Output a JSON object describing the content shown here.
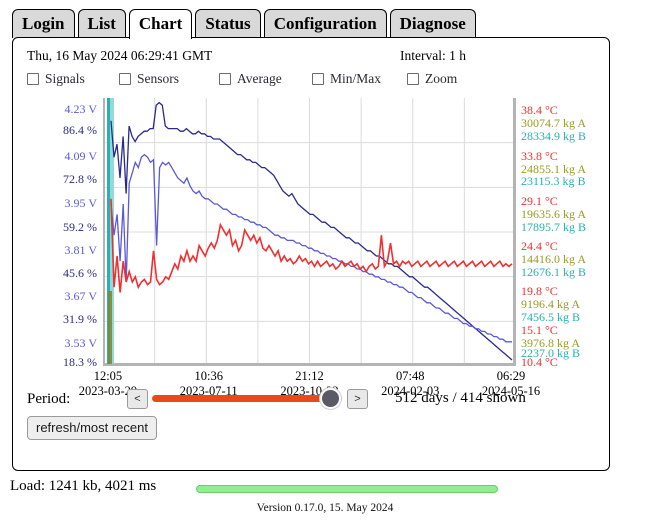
{
  "tabs": [
    {
      "label": "Login",
      "active": false
    },
    {
      "label": "List",
      "active": false
    },
    {
      "label": "Chart",
      "active": true
    },
    {
      "label": "Status",
      "active": false
    },
    {
      "label": "Configuration",
      "active": false
    },
    {
      "label": "Diagnose",
      "active": false
    }
  ],
  "header": {
    "datetime": "Thu, 16 May 2024 06:29:41 GMT",
    "interval": "Interval: 1 h"
  },
  "checkboxes": [
    {
      "label": "Signals",
      "checked": false,
      "x": 0
    },
    {
      "label": "Sensors",
      "checked": false,
      "x": 92
    },
    {
      "label": "Average",
      "checked": false,
      "x": 192
    },
    {
      "label": "Min/Max",
      "checked": false,
      "x": 285
    },
    {
      "label": "Zoom",
      "checked": false,
      "x": 380
    }
  ],
  "period": {
    "label": "Period:",
    "prev": "<",
    "next": ">",
    "summary": "512 days / 414 shown",
    "slider_percent": 88,
    "refresh_label": "refresh/most recent"
  },
  "status": {
    "load": "Load: 1241 kb, 4021 ms",
    "version": "Version 0.17.0, 15. May 2024",
    "load_progress_percent": 100
  },
  "colors": {
    "volt": "#5a5ad8",
    "percent": "#2a2a8c",
    "temperature": "#f03030",
    "kg_a": "#9a9a28",
    "kg_b": "#2ab0b0",
    "slider_track": "#e8491d",
    "slider_thumb": "#5a5a66",
    "load_bar": "#90ee90",
    "grid": "#dcdcdc",
    "axis": "#b4b4b4"
  },
  "chart_data": {
    "type": "line",
    "title": "",
    "xlabel": "",
    "ylabel": "",
    "grid": true,
    "legend": "none",
    "x_ticks": [
      {
        "time": "12:05",
        "date": "2023-03-29",
        "pos": 0.012
      },
      {
        "time": "10:36",
        "date": "2023-07-11",
        "pos": 0.256
      },
      {
        "time": "21:12",
        "date": "2023-10-22",
        "pos": 0.5
      },
      {
        "time": "07:48",
        "date": "2024-02-03",
        "pos": 0.744
      },
      {
        "time": "06:29",
        "date": "2024-05-16",
        "pos": 0.988
      }
    ],
    "left_axis_ticks": [
      {
        "label": "4.23 V",
        "unit": "V",
        "value": 4.23,
        "color": "#5a5ad8",
        "pos": 0.02
      },
      {
        "label": "86.4 %",
        "unit": "%",
        "value": 86.4,
        "color": "#2a2a8c",
        "pos": 0.1
      },
      {
        "label": "4.09 V",
        "unit": "V",
        "value": 4.09,
        "color": "#5a5ad8",
        "pos": 0.2
      },
      {
        "label": "72.8 %",
        "unit": "%",
        "value": 72.8,
        "color": "#2a2a8c",
        "pos": 0.29
      },
      {
        "label": "3.95 V",
        "unit": "V",
        "value": 3.95,
        "color": "#5a5ad8",
        "pos": 0.385
      },
      {
        "label": "59.2 %",
        "unit": "%",
        "value": 59.2,
        "color": "#2a2a8c",
        "pos": 0.475
      },
      {
        "label": "3.81 V",
        "unit": "V",
        "value": 3.81,
        "color": "#5a5ad8",
        "pos": 0.565
      },
      {
        "label": "45.6 %",
        "unit": "%",
        "value": 45.6,
        "color": "#2a2a8c",
        "pos": 0.655
      },
      {
        "label": "3.67 V",
        "unit": "V",
        "value": 3.67,
        "color": "#5a5ad8",
        "pos": 0.745
      },
      {
        "label": "31.9 %",
        "unit": "%",
        "value": 31.9,
        "color": "#2a2a8c",
        "pos": 0.835
      },
      {
        "label": "3.53 V",
        "unit": "V",
        "value": 3.53,
        "color": "#5a5ad8",
        "pos": 0.925
      },
      {
        "label": "18.3 %",
        "unit": "%",
        "value": 18.3,
        "color": "#2a2a8c",
        "pos": 1.0
      }
    ],
    "right_axis_ticks": [
      {
        "label": "38.4 °C",
        "unit": "°C",
        "value": 38.4,
        "color": "#f03030",
        "pos": 0.025
      },
      {
        "label": "30074.7 kg A",
        "unit": "kg A",
        "value": 30074.7,
        "color": "#9a9a28",
        "pos": 0.075
      },
      {
        "label": "28334.9 kg B",
        "unit": "kg B",
        "value": 28334.9,
        "color": "#2ab0b0",
        "pos": 0.125
      },
      {
        "label": "33.8 °C",
        "unit": "°C",
        "value": 33.8,
        "color": "#f03030",
        "pos": 0.2
      },
      {
        "label": "24855.1 kg A",
        "unit": "kg A",
        "value": 24855.1,
        "color": "#9a9a28",
        "pos": 0.25
      },
      {
        "label": "23115.3 kg B",
        "unit": "kg B",
        "value": 23115.3,
        "color": "#2ab0b0",
        "pos": 0.3
      },
      {
        "label": "29.1 °C",
        "unit": "°C",
        "value": 29.1,
        "color": "#f03030",
        "pos": 0.375
      },
      {
        "label": "19635.6 kg A",
        "unit": "kg A",
        "value": 19635.6,
        "color": "#9a9a28",
        "pos": 0.425
      },
      {
        "label": "17895.7 kg B",
        "unit": "kg B",
        "value": 17895.7,
        "color": "#2ab0b0",
        "pos": 0.475
      },
      {
        "label": "24.4 °C",
        "unit": "°C",
        "value": 24.4,
        "color": "#f03030",
        "pos": 0.55
      },
      {
        "label": "14416.0 kg A",
        "unit": "kg A",
        "value": 14416.0,
        "color": "#9a9a28",
        "pos": 0.6
      },
      {
        "label": "12676.1 kg B",
        "unit": "kg B",
        "value": 12676.1,
        "color": "#2ab0b0",
        "pos": 0.65
      },
      {
        "label": "19.8 °C",
        "unit": "°C",
        "value": 19.8,
        "color": "#f03030",
        "pos": 0.725
      },
      {
        "label": "9196.4 kg A",
        "unit": "kg A",
        "value": 9196.4,
        "color": "#9a9a28",
        "pos": 0.775
      },
      {
        "label": "7456.5 kg B",
        "unit": "kg B",
        "value": 7456.5,
        "color": "#2ab0b0",
        "pos": 0.825
      },
      {
        "label": "15.1 °C",
        "unit": "°C",
        "value": 15.1,
        "color": "#f03030",
        "pos": 0.875
      },
      {
        "label": "3976.8 kg A",
        "unit": "kg A",
        "value": 3976.8,
        "color": "#9a9a28",
        "pos": 0.925
      },
      {
        "label": "2237.0 kg B",
        "unit": "kg B",
        "value": 2237.0,
        "color": "#2ab0b0",
        "pos": 0.965
      },
      {
        "label": "10.4 °C",
        "unit": "°C",
        "value": 10.4,
        "color": "#f03030",
        "pos": 1.0
      }
    ],
    "series": [
      {
        "name": "percent",
        "color": "#2a2a8c",
        "values": [
          8,
          22,
          17,
          30,
          14,
          36,
          10,
          14,
          16,
          14,
          13,
          12,
          12,
          11,
          11,
          2,
          1,
          2,
          10,
          11,
          11,
          11,
          11,
          12,
          12,
          11,
          12,
          13,
          13,
          12,
          13,
          13,
          14,
          14,
          15,
          15,
          15,
          16,
          17,
          18,
          19,
          20,
          21,
          21,
          22,
          23,
          23,
          24,
          24,
          25,
          26,
          26,
          27,
          28,
          29,
          31,
          33,
          35,
          36,
          37,
          36,
          38,
          40,
          41,
          42,
          43,
          44,
          44,
          45,
          46,
          47,
          47,
          48,
          49,
          49,
          50,
          51,
          52,
          53,
          53,
          54,
          55,
          55,
          56,
          57,
          58,
          58,
          59,
          60,
          60,
          61,
          62,
          63,
          63,
          64,
          64,
          65,
          66,
          67,
          68,
          68,
          69,
          70,
          71,
          72,
          72,
          73,
          74,
          75,
          76,
          77,
          78,
          79,
          80,
          81,
          82,
          83,
          84,
          85,
          86,
          87,
          88,
          89,
          90,
          91,
          92,
          93,
          94,
          95,
          96,
          97,
          98,
          99,
          100
        ]
      },
      {
        "name": "volt",
        "color": "#5a5ad8",
        "values": [
          40,
          52,
          44,
          62,
          40,
          70,
          32,
          28,
          24,
          26,
          22,
          21,
          22,
          24,
          23,
          56,
          26,
          24,
          25,
          24,
          26,
          28,
          30,
          31,
          32,
          30,
          33,
          35,
          36,
          35,
          37,
          38,
          38,
          39,
          40,
          40,
          41,
          42,
          42,
          43,
          44,
          44,
          45,
          45,
          46,
          46,
          47,
          47,
          48,
          48,
          49,
          49,
          50,
          51,
          52,
          52,
          53,
          53,
          54,
          54,
          54,
          55,
          55,
          56,
          56,
          57,
          57,
          58,
          58,
          59,
          59,
          60,
          60,
          61,
          61,
          62,
          62,
          63,
          63,
          64,
          64,
          65,
          65,
          66,
          66,
          67,
          67,
          68,
          68,
          69,
          69,
          70,
          70,
          71,
          71,
          72,
          72,
          73,
          74,
          74,
          75,
          76,
          76,
          77,
          78,
          78,
          79,
          80,
          80,
          81,
          82,
          82,
          83,
          84,
          84,
          85,
          86,
          86,
          87,
          87,
          88,
          88,
          89,
          89,
          90,
          90,
          91,
          91,
          92,
          92,
          93,
          93,
          93
        ]
      },
      {
        "name": "temperature",
        "color": "#f03030",
        "values": [
          38,
          72,
          60,
          74,
          62,
          70,
          66,
          70,
          68,
          72,
          70,
          69,
          71,
          70,
          58,
          69,
          71,
          70,
          68,
          69,
          66,
          63,
          65,
          60,
          62,
          58,
          62,
          60,
          62,
          56,
          58,
          60,
          57,
          55,
          57,
          54,
          48,
          50,
          52,
          50,
          56,
          54,
          58,
          56,
          50,
          52,
          54,
          52,
          55,
          53,
          57,
          58,
          56,
          58,
          60,
          58,
          62,
          60,
          62,
          61,
          63,
          62,
          60,
          62,
          61,
          63,
          62,
          64,
          62,
          64,
          63,
          62,
          64,
          63,
          65,
          64,
          62,
          64,
          63,
          62,
          64,
          63,
          65,
          64,
          66,
          64,
          63,
          65,
          64,
          52,
          64,
          62,
          55,
          63,
          62,
          64,
          62,
          63,
          62,
          64,
          63,
          62,
          64,
          63,
          62,
          64,
          63,
          62,
          64,
          63,
          62,
          64,
          63,
          62,
          64,
          63,
          62,
          64,
          63,
          62,
          64,
          63,
          62,
          64,
          63,
          62,
          64,
          63,
          62,
          64,
          63,
          64,
          63
        ]
      }
    ],
    "left_markers": {
      "color_a": "#2ab0b0",
      "color_b": "#7fd4d4",
      "color_c": "#7a8a3a"
    }
  }
}
